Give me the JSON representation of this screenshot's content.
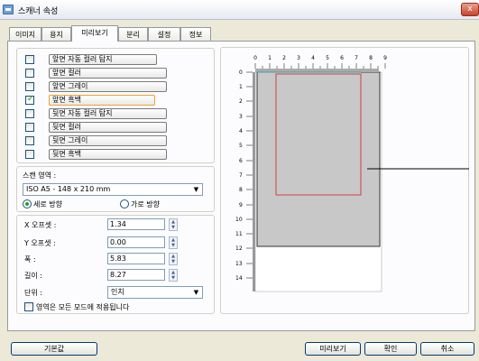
{
  "window": {
    "title": "스캐너 속성",
    "close_label": "x"
  },
  "tabs": [
    "이미지",
    "용지",
    "미리보기",
    "분리",
    "설정",
    "정보"
  ],
  "active_tab": "미리보기",
  "image_options": [
    {
      "label": "앞면 자동 컬러 탐지",
      "checked": false
    },
    {
      "label": "앞면 컬러",
      "checked": false
    },
    {
      "label": "앞면 그레이",
      "checked": false
    },
    {
      "label": "앞면 흑백",
      "checked": true
    },
    {
      "label": "뒷면 자동 컬러 탐지",
      "checked": false
    },
    {
      "label": "뒷면 컬러",
      "checked": false
    },
    {
      "label": "뒷면 그레이",
      "checked": false
    },
    {
      "label": "뒷면 흑백",
      "checked": false
    }
  ],
  "scan_area": {
    "label": "스캔 영역 :",
    "value": "ISO A5 - 148 x 210 mm",
    "orientation_portrait": "세로 방향",
    "orientation_landscape": "가로 방향"
  },
  "params": [
    {
      "label": "X 오프셋 :",
      "value": "1.34"
    },
    {
      "label": "Y 오프셋 :",
      "value": "0.00"
    },
    {
      "label": "폭 :",
      "value": "5.83"
    },
    {
      "label": "길이 :",
      "value": "8.27"
    }
  ],
  "unit": {
    "label": "단위 :",
    "value": "인치"
  },
  "apply_all": {
    "label": "영역은 모든 모드에 적용됩니다",
    "checked": false
  },
  "ruler": {
    "x_labels": [
      "0",
      "1",
      "2",
      "3",
      "4",
      "5",
      "6",
      "7",
      "8",
      "9"
    ],
    "y_labels": [
      "0",
      "1",
      "2",
      "3",
      "4",
      "5",
      "6",
      "7",
      "8",
      "9",
      "10",
      "11",
      "12",
      "13",
      "14"
    ]
  },
  "buttons": {
    "default": "기본값",
    "preview": "미리보기",
    "ok": "확인",
    "cancel": "취소"
  }
}
